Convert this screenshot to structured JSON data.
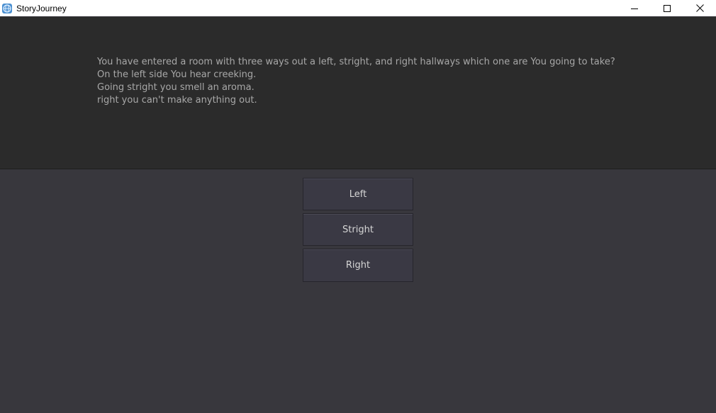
{
  "window": {
    "title": "StoryJourney"
  },
  "story": {
    "lines": [
      "You have entered a room with three ways out a left, stright, and right hallways which one are You going to take?",
      "On the left side You hear creeking.",
      "Going stright you smell an aroma.",
      "right you can't make anything out."
    ]
  },
  "choices": [
    {
      "label": "Left"
    },
    {
      "label": "Stright"
    },
    {
      "label": "Right"
    }
  ],
  "icons": {
    "app": "app-globe-icon",
    "minimize": "minimize-icon",
    "maximize": "maximize-icon",
    "close": "close-icon"
  },
  "colors": {
    "story_panel_bg": "#2b2b2b",
    "main_bg": "#38373d",
    "button_bg": "#3a3944",
    "story_text": "#a8a8a8",
    "button_text": "#d6d6d6"
  }
}
